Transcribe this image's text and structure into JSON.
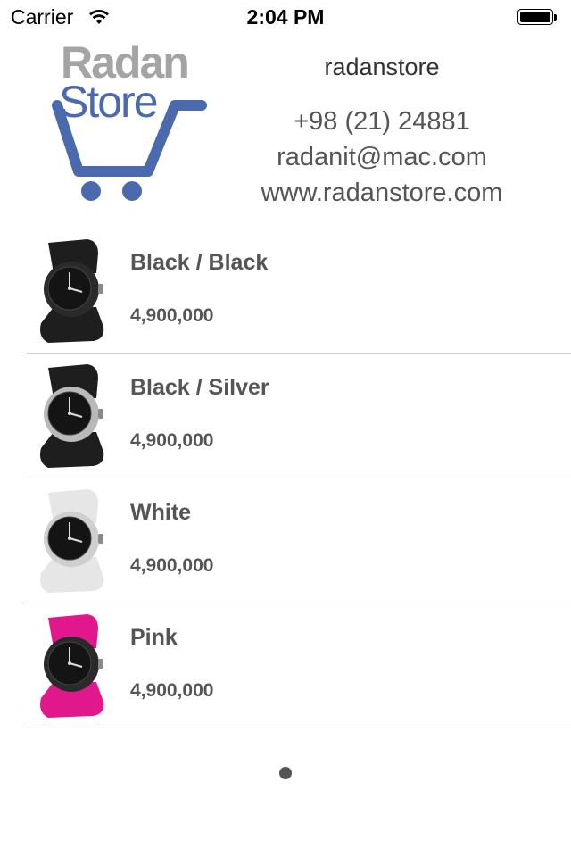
{
  "status_bar": {
    "carrier": "Carrier",
    "time": "2:04 PM",
    "battery_level": 1.0
  },
  "header": {
    "logo_word_1": "Radan",
    "logo_word_2": "Store",
    "store_name": "radanstore",
    "phone": "+98 (21) 24881",
    "email": "radanit@mac.com",
    "website": "www.radanstore.com"
  },
  "products": [
    {
      "name": "Black / Black",
      "price": "4,900,000",
      "strap_color": "#1e1e1e",
      "case_color": "#2a2a2a"
    },
    {
      "name": "Black / Silver",
      "price": "4,900,000",
      "strap_color": "#1e1e1e",
      "case_color": "#b9b9b9"
    },
    {
      "name": "White",
      "price": "4,900,000",
      "strap_color": "#e6e6e6",
      "case_color": "#cfcfcf"
    },
    {
      "name": "Pink",
      "price": "4,900,000",
      "strap_color": "#e0188c",
      "case_color": "#2a2a2a"
    }
  ],
  "pagination": {
    "current": 1,
    "total": 1
  },
  "colors": {
    "brand_blue": "#4b6aae",
    "brand_gray": "#a4a4a4",
    "text": "#555555",
    "separator": "#d0d0d0"
  }
}
